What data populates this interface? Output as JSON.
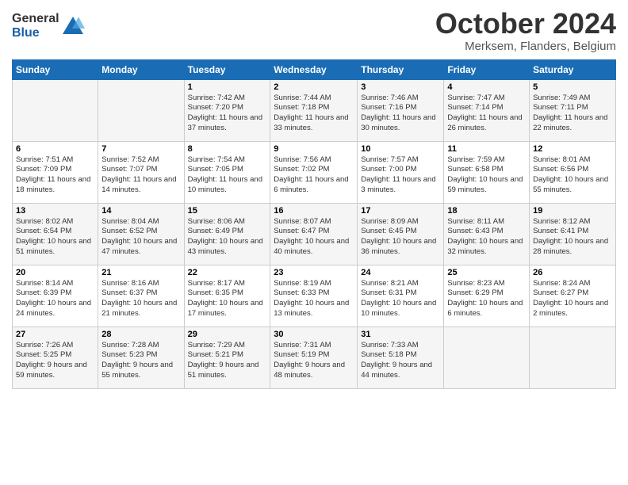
{
  "header": {
    "logo_general": "General",
    "logo_blue": "Blue",
    "title": "October 2024",
    "subtitle": "Merksem, Flanders, Belgium"
  },
  "days_of_week": [
    "Sunday",
    "Monday",
    "Tuesday",
    "Wednesday",
    "Thursday",
    "Friday",
    "Saturday"
  ],
  "weeks": [
    [
      {
        "day": "",
        "info": ""
      },
      {
        "day": "",
        "info": ""
      },
      {
        "day": "1",
        "info": "Sunrise: 7:42 AM\nSunset: 7:20 PM\nDaylight: 11 hours and 37 minutes."
      },
      {
        "day": "2",
        "info": "Sunrise: 7:44 AM\nSunset: 7:18 PM\nDaylight: 11 hours and 33 minutes."
      },
      {
        "day": "3",
        "info": "Sunrise: 7:46 AM\nSunset: 7:16 PM\nDaylight: 11 hours and 30 minutes."
      },
      {
        "day": "4",
        "info": "Sunrise: 7:47 AM\nSunset: 7:14 PM\nDaylight: 11 hours and 26 minutes."
      },
      {
        "day": "5",
        "info": "Sunrise: 7:49 AM\nSunset: 7:11 PM\nDaylight: 11 hours and 22 minutes."
      }
    ],
    [
      {
        "day": "6",
        "info": "Sunrise: 7:51 AM\nSunset: 7:09 PM\nDaylight: 11 hours and 18 minutes."
      },
      {
        "day": "7",
        "info": "Sunrise: 7:52 AM\nSunset: 7:07 PM\nDaylight: 11 hours and 14 minutes."
      },
      {
        "day": "8",
        "info": "Sunrise: 7:54 AM\nSunset: 7:05 PM\nDaylight: 11 hours and 10 minutes."
      },
      {
        "day": "9",
        "info": "Sunrise: 7:56 AM\nSunset: 7:02 PM\nDaylight: 11 hours and 6 minutes."
      },
      {
        "day": "10",
        "info": "Sunrise: 7:57 AM\nSunset: 7:00 PM\nDaylight: 11 hours and 3 minutes."
      },
      {
        "day": "11",
        "info": "Sunrise: 7:59 AM\nSunset: 6:58 PM\nDaylight: 10 hours and 59 minutes."
      },
      {
        "day": "12",
        "info": "Sunrise: 8:01 AM\nSunset: 6:56 PM\nDaylight: 10 hours and 55 minutes."
      }
    ],
    [
      {
        "day": "13",
        "info": "Sunrise: 8:02 AM\nSunset: 6:54 PM\nDaylight: 10 hours and 51 minutes."
      },
      {
        "day": "14",
        "info": "Sunrise: 8:04 AM\nSunset: 6:52 PM\nDaylight: 10 hours and 47 minutes."
      },
      {
        "day": "15",
        "info": "Sunrise: 8:06 AM\nSunset: 6:49 PM\nDaylight: 10 hours and 43 minutes."
      },
      {
        "day": "16",
        "info": "Sunrise: 8:07 AM\nSunset: 6:47 PM\nDaylight: 10 hours and 40 minutes."
      },
      {
        "day": "17",
        "info": "Sunrise: 8:09 AM\nSunset: 6:45 PM\nDaylight: 10 hours and 36 minutes."
      },
      {
        "day": "18",
        "info": "Sunrise: 8:11 AM\nSunset: 6:43 PM\nDaylight: 10 hours and 32 minutes."
      },
      {
        "day": "19",
        "info": "Sunrise: 8:12 AM\nSunset: 6:41 PM\nDaylight: 10 hours and 28 minutes."
      }
    ],
    [
      {
        "day": "20",
        "info": "Sunrise: 8:14 AM\nSunset: 6:39 PM\nDaylight: 10 hours and 24 minutes."
      },
      {
        "day": "21",
        "info": "Sunrise: 8:16 AM\nSunset: 6:37 PM\nDaylight: 10 hours and 21 minutes."
      },
      {
        "day": "22",
        "info": "Sunrise: 8:17 AM\nSunset: 6:35 PM\nDaylight: 10 hours and 17 minutes."
      },
      {
        "day": "23",
        "info": "Sunrise: 8:19 AM\nSunset: 6:33 PM\nDaylight: 10 hours and 13 minutes."
      },
      {
        "day": "24",
        "info": "Sunrise: 8:21 AM\nSunset: 6:31 PM\nDaylight: 10 hours and 10 minutes."
      },
      {
        "day": "25",
        "info": "Sunrise: 8:23 AM\nSunset: 6:29 PM\nDaylight: 10 hours and 6 minutes."
      },
      {
        "day": "26",
        "info": "Sunrise: 8:24 AM\nSunset: 6:27 PM\nDaylight: 10 hours and 2 minutes."
      }
    ],
    [
      {
        "day": "27",
        "info": "Sunrise: 7:26 AM\nSunset: 5:25 PM\nDaylight: 9 hours and 59 minutes."
      },
      {
        "day": "28",
        "info": "Sunrise: 7:28 AM\nSunset: 5:23 PM\nDaylight: 9 hours and 55 minutes."
      },
      {
        "day": "29",
        "info": "Sunrise: 7:29 AM\nSunset: 5:21 PM\nDaylight: 9 hours and 51 minutes."
      },
      {
        "day": "30",
        "info": "Sunrise: 7:31 AM\nSunset: 5:19 PM\nDaylight: 9 hours and 48 minutes."
      },
      {
        "day": "31",
        "info": "Sunrise: 7:33 AM\nSunset: 5:18 PM\nDaylight: 9 hours and 44 minutes."
      },
      {
        "day": "",
        "info": ""
      },
      {
        "day": "",
        "info": ""
      }
    ]
  ]
}
